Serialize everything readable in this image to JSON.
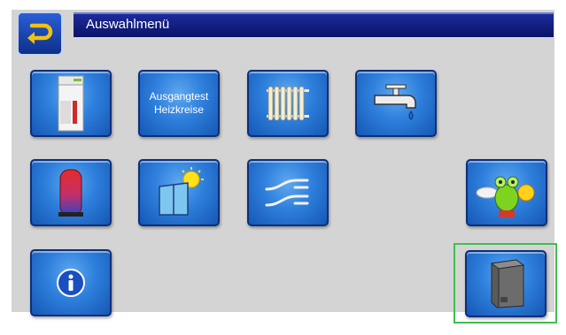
{
  "header": {
    "title": "Auswahlmenü",
    "back_icon": "back-arrow-icon"
  },
  "tiles": [
    {
      "name": "boiler-tile",
      "icon": "pellet-boiler-icon"
    },
    {
      "name": "output-test-heating-circuits-tile",
      "line1": "Ausgangtest",
      "line2": "Heizkreise"
    },
    {
      "name": "radiator-tile",
      "icon": "radiator-icon"
    },
    {
      "name": "hot-water-tap-tile",
      "icon": "water-tap-icon"
    },
    {
      "name": "buffer-tank-tile",
      "icon": "buffer-tank-icon"
    },
    {
      "name": "solar-tile",
      "icon": "solar-collector-icon"
    },
    {
      "name": "switch-valves-tile",
      "icon": "switching-valve-icon"
    },
    {
      "name": "frog-tile",
      "icon": "frog-mascot-icon"
    },
    {
      "name": "info-tile",
      "icon": "info-icon"
    },
    {
      "name": "pellet-storage-tile",
      "icon": "pellet-storage-icon",
      "selected": true
    }
  ],
  "colors": {
    "title_bar": "#0b1468",
    "tile_blue": "#2e7fdc",
    "screen_bg": "#d4d4d4",
    "selection_frame": "#3fbf4f"
  }
}
